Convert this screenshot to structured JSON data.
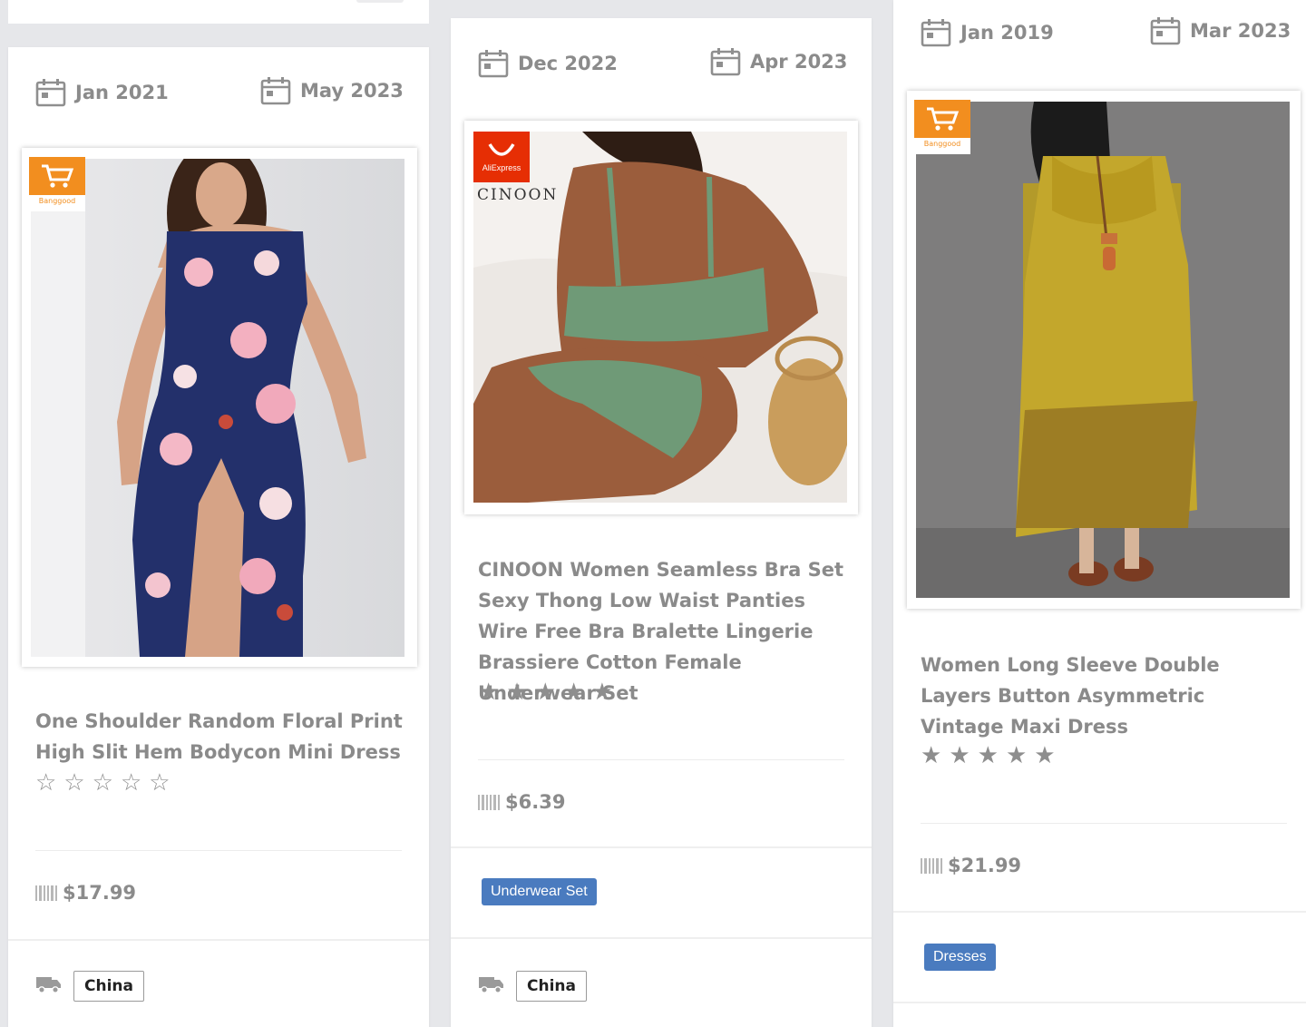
{
  "cards": [
    {
      "date_start": "Jan 2021",
      "date_end": "May 2023",
      "store_badge": "Banggood",
      "title": "One Shoulder Random Floral Print High Slit Hem Bodycon Mini Dress",
      "rating": 0,
      "rating_max": 5,
      "price": "$17.99",
      "category": "",
      "ships_from": "China"
    },
    {
      "date_start": "Dec 2022",
      "date_end": "Apr 2023",
      "store_badge": "AliExpress",
      "image_brand": "CINOON",
      "title": "CINOON Women Seamless Bra Set Sexy Thong Low Waist Panties Wire Free Bra Bralette Lingerie Brassiere Cotton Female Underwear Set",
      "rating": 5,
      "rating_max": 5,
      "price": "$6.39",
      "category": "Underwear Set",
      "ships_from": "China"
    },
    {
      "date_start": "Jan 2019",
      "date_end": "Mar 2023",
      "store_badge": "Banggood",
      "title": "Women Long Sleeve Double Layers Button Asymmetric Vintage Maxi Dress",
      "rating": 5,
      "rating_max": 5,
      "price": "$21.99",
      "category": "Dresses",
      "ships_from": ""
    }
  ],
  "icons": {
    "date": "calendar-icon",
    "shipping": "truck-icon",
    "price": "barcode-icon",
    "store": "shopping-cart-icon"
  },
  "colors": {
    "text_muted": "#8a8a8a",
    "tag_blue": "#4a7bbf",
    "banggood_orange": "#f28e1f",
    "aliexpress_red": "#e62e04"
  }
}
